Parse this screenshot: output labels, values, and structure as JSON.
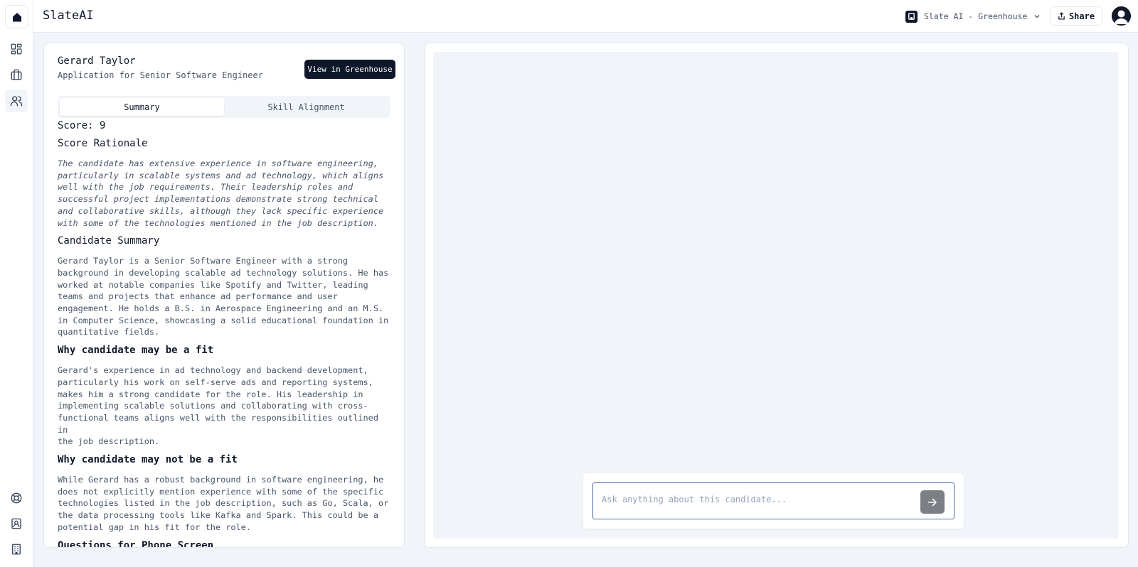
{
  "app": {
    "title": "SlateAI"
  },
  "workspace": {
    "name": "Slate AI - Greenhouse"
  },
  "share": {
    "label": "Share"
  },
  "candidate": {
    "name": "Gerard Taylor",
    "application": "Application for Senior Software Engineer",
    "view_button": "View in Greenhouse"
  },
  "tabs": [
    {
      "label": "Summary",
      "active": true
    },
    {
      "label": "Skill Alignment",
      "active": false
    }
  ],
  "summary": {
    "score_text": "Score: 9",
    "rationale_heading": "Score Rationale",
    "rationale_text": "The candidate has extensive experience in software engineering,\nparticularly in scalable systems and ad technology, which aligns\nwell with the job requirements. Their leadership roles and\nsuccessful project implementations demonstrate strong technical\nand collaborative skills, although they lack specific experience\nwith some of the technologies mentioned in the job description.",
    "summary_heading": "Candidate Summary",
    "summary_text": "Gerard Taylor is a Senior Software Engineer with a strong\nbackground in developing scalable ad technology solutions. He has\nworked at notable companies like Spotify and Twitter, leading\nteams and projects that enhance ad performance and user\nengagement. He holds a B.S. in Aerospace Engineering and an M.S.\nin Computer Science, showcasing a solid educational foundation in\nquantitative fields.",
    "fit_heading": "Why candidate may be a fit",
    "fit_text": "Gerard's experience in ad technology and backend development,\nparticularly his work on self-serve ads and reporting systems,\nmakes him a strong candidate for the role. His leadership in\nimplementing scalable solutions and collaborating with cross-\nfunctional teams aligns well with the responsibilities outlined in\nthe job description.",
    "nofit_heading": "Why candidate may not be a fit",
    "nofit_text": "While Gerard has a robust background in software engineering, he\ndoes not explicitly mention experience with some of the specific\ntechnologies listed in the job description, such as Go, Scala, or\nthe data processing tools like Kafka and Spark. This could be a\npotential gap in his fit for the role.",
    "questions_heading": "Questions for Phone Screen"
  },
  "chat": {
    "placeholder": "Ask anything about this candidate..."
  },
  "icons": {
    "logo": "home-icon",
    "nav": [
      "dashboard-icon",
      "briefcase-icon",
      "users-icon"
    ],
    "bottom": [
      "help-icon",
      "contact-icon",
      "building-icon"
    ],
    "send": "arrow-right-icon"
  },
  "colors": {
    "accent": "#0f172a",
    "background": "#f1f5f9",
    "input_border": "#4f6aa8"
  }
}
